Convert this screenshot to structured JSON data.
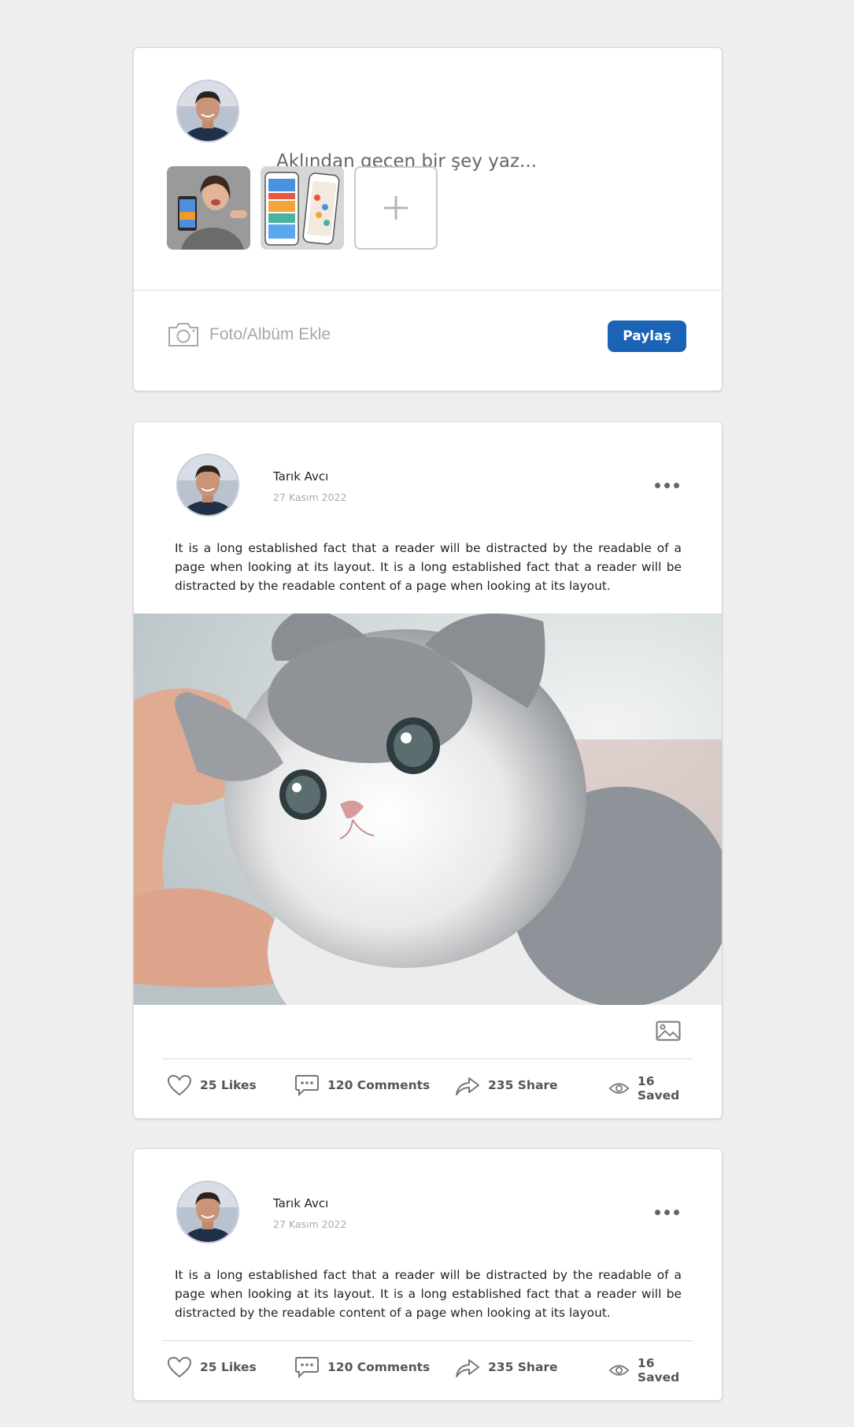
{
  "composer": {
    "placeholder": "Aklından geçen bir şey yaz...",
    "add_photo_label": "Foto/Albüm Ekle",
    "share_label": "Paylaş"
  },
  "posts": [
    {
      "author": "Tarık Avcı",
      "date": "27 Kasım 2022",
      "text": "It is a long established fact that a reader will be distracted by the readable of a page when looking at its layout. It is a long established fact that a reader will be distracted by the readable content of a page when looking at its layout.",
      "has_image": true,
      "stats": {
        "likes": "25 Likes",
        "comments": "120 Comments",
        "shares": "235 Share",
        "saved": "16 Saved"
      }
    },
    {
      "author": "Tarık Avcı",
      "date": "27 Kasım 2022",
      "text": "It is a long established fact that a reader will be distracted by the readable of a page when looking at its layout. It is a long established fact that a reader will be distracted by the readable content of a page when looking at its layout.",
      "has_image": false,
      "stats": {
        "likes": "25 Likes",
        "comments": "120 Comments",
        "shares": "235 Share",
        "saved": "16 Saved"
      }
    }
  ],
  "colors": {
    "background": "#eeeeee",
    "card": "#ffffff",
    "accent": "#1a63b5",
    "muted": "#aaaaaa"
  }
}
